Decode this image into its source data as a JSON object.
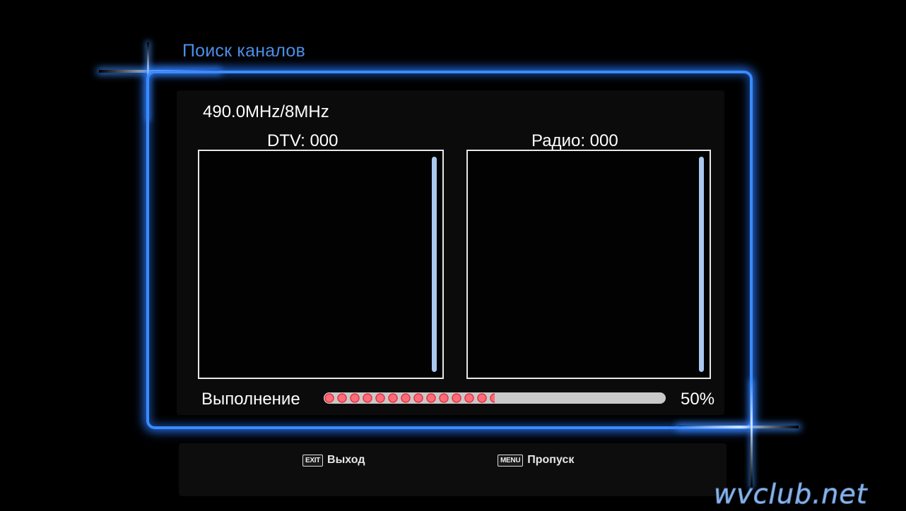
{
  "screen": {
    "title": "Поиск каналов"
  },
  "scan": {
    "frequency": "490.0MHz/8MHz",
    "dtv_label": "DTV: 000",
    "radio_label": "Радио: 000"
  },
  "progress": {
    "label": "Выполнение",
    "percent_text": "50%",
    "value": 0.5
  },
  "footer": {
    "exit_key": "EXIT",
    "exit_label": "Выход",
    "menu_key": "MENU",
    "menu_label": "Пропуск"
  },
  "watermark": "wvclub.net",
  "colors": {
    "accent": "#3a8bff",
    "progress_dot": "#e0333f",
    "scrollbar": "#a9c8ee"
  }
}
